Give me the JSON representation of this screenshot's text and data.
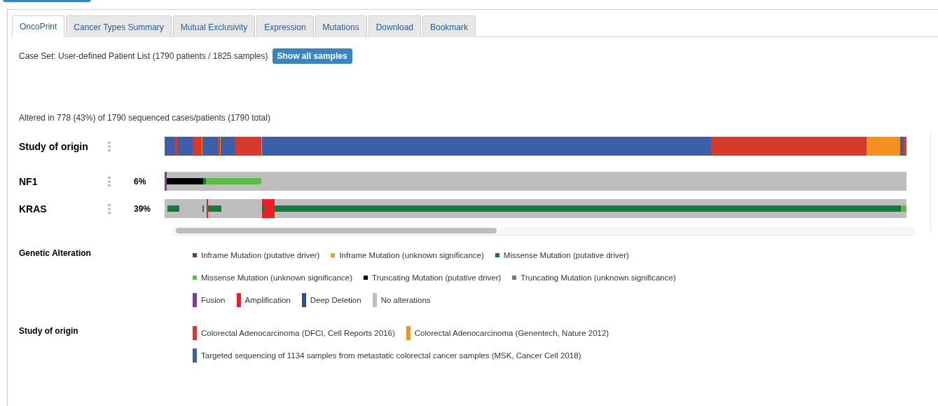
{
  "tabs": [
    {
      "label": "OncoPrint",
      "selected": true
    },
    {
      "label": "Cancer Types Summary",
      "selected": false
    },
    {
      "label": "Mutual Exclusivity",
      "selected": false
    },
    {
      "label": "Expression",
      "selected": false
    },
    {
      "label": "Mutations",
      "selected": false
    },
    {
      "label": "Download",
      "selected": false
    },
    {
      "label": "Bookmark",
      "selected": false
    }
  ],
  "case_set": {
    "text": "Case Set: User-defined Patient List (1790 patients / 1825 samples)",
    "button": "Show all samples"
  },
  "altered_summary": "Altered in 778 (43%) of 1790 sequenced cases/patients (1790 total)",
  "tracks": [
    {
      "kind": "clinical",
      "label": "Study of origin"
    },
    {
      "kind": "gene",
      "label": "NF1",
      "percent": "6%"
    },
    {
      "kind": "gene",
      "label": "KRAS",
      "percent": "39%"
    }
  ],
  "legends": [
    {
      "title": "Genetic Alteration",
      "lines": [
        {
          "items": [
            {
              "label": "Inframe Mutation (putative driver)",
              "kind": "square",
              "color": "#8b3a1e"
            },
            {
              "label": "Inframe Mutation (unknown significance)",
              "kind": "square",
              "color": "#f29b45"
            },
            {
              "label": "Missense Mutation (putative driver)",
              "kind": "square",
              "color": "#127b3b"
            }
          ]
        },
        {
          "items": [
            {
              "label": "Missense Mutation (unknown significance)",
              "kind": "square",
              "color": "#5cba4a"
            },
            {
              "label": "Truncating Mutation (putative driver)",
              "kind": "square",
              "color": "#000000"
            },
            {
              "label": "Truncating Mutation (unknown significance)",
              "kind": "square",
              "color": "#6b7a8c"
            }
          ]
        },
        {
          "items": [
            {
              "label": "Fusion",
              "kind": "bar",
              "color": "#7d3c98"
            },
            {
              "label": "Amplification",
              "kind": "bar",
              "color": "#ee1c24"
            },
            {
              "label": "Deep Deletion",
              "kind": "bar",
              "color": "#2c4e9c"
            },
            {
              "label": "No alterations",
              "kind": "bar",
              "color": "#bebebe"
            }
          ]
        }
      ]
    },
    {
      "title": "Study of origin",
      "lines": [
        {
          "items": [
            {
              "label": "Colorectal Adenocarcinoma (DFCI, Cell Reports 2016)",
              "kind": "bar",
              "color": "#d63a2a"
            },
            {
              "label": "Colorectal Adenocarcinoma (Genentech, Nature 2012)",
              "kind": "bar",
              "color": "#f3901e"
            }
          ]
        },
        {
          "items": [
            {
              "label": "Targeted sequencing of 1134 samples from metastatic colorectal cancer samples (MSK, Cancer Cell 2018)",
              "kind": "bar",
              "color": "#3d5fa8"
            }
          ]
        }
      ]
    }
  ]
}
